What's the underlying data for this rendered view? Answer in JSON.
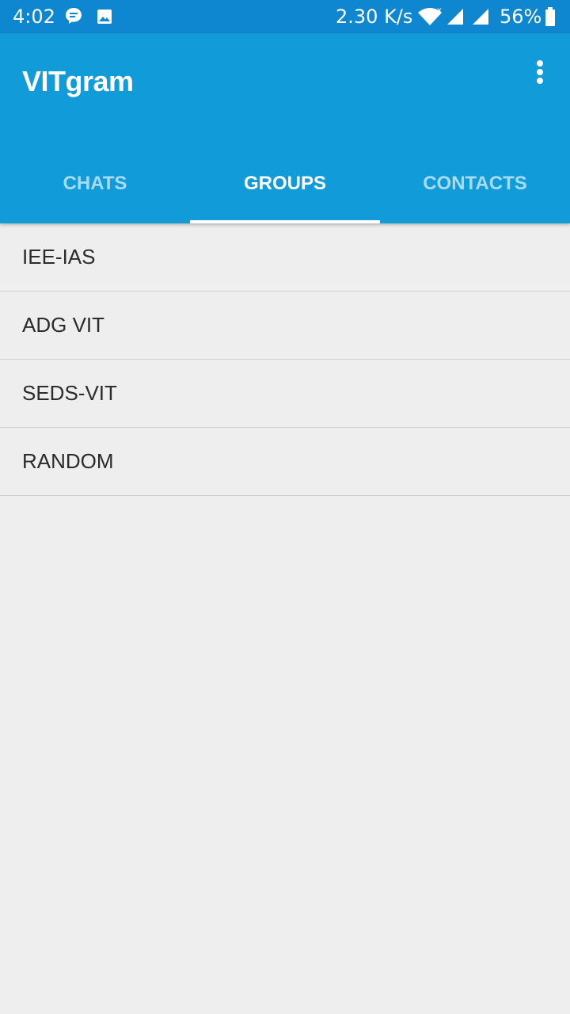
{
  "status_bar": {
    "time": "4:02",
    "net_speed": "2.30 K/s",
    "battery_percent": "56%",
    "icons": [
      "message-notification-icon",
      "image-notification-icon",
      "wifi-icon",
      "signal-icon",
      "signal-icon",
      "battery-icon"
    ]
  },
  "app_bar": {
    "title": "VITgram",
    "menu_icon": "overflow-menu-icon"
  },
  "tabs": [
    {
      "label": "CHATS",
      "active": false
    },
    {
      "label": "GROUPS",
      "active": true
    },
    {
      "label": "CONTACTS",
      "active": false
    }
  ],
  "groups": [
    {
      "name": "IEE-IAS"
    },
    {
      "name": "ADG VIT"
    },
    {
      "name": "SEDS-VIT"
    },
    {
      "name": "RANDOM"
    }
  ],
  "colors": {
    "status_bar": "#0f86d0",
    "app_bar": "#129bd9",
    "background": "#eeeeee",
    "inactive_tab": "#a9dcf4",
    "active_tab": "#ffffff"
  }
}
